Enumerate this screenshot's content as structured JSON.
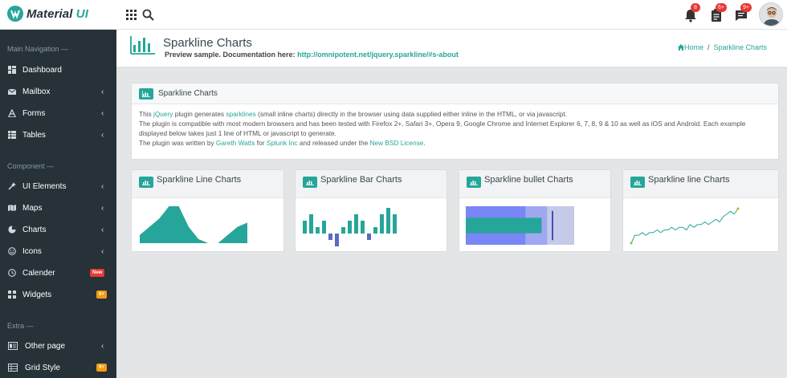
{
  "brand": {
    "name_part1": "Material",
    "name_part2": "UI",
    "accent": "#26a69a"
  },
  "topbar": {
    "icons": [
      "apps-grid-icon",
      "search-icon"
    ],
    "notifications": [
      {
        "icon": "bell-icon",
        "badge": "8"
      },
      {
        "icon": "clipboard-icon",
        "badge": "6+"
      },
      {
        "icon": "chat-icon",
        "badge": "9+"
      }
    ],
    "avatar": "user-avatar"
  },
  "sidebar": {
    "sections": [
      {
        "title": "Main Navigation —"
      },
      {
        "title": "Component —"
      },
      {
        "title": "Extra —"
      }
    ],
    "items": [
      {
        "label": "Dashboard",
        "icon": "dashboard-icon",
        "chevron": ""
      },
      {
        "label": "Mailbox",
        "icon": "mail-icon",
        "chevron": "‹"
      },
      {
        "label": "Forms",
        "icon": "font-icon",
        "chevron": "‹"
      },
      {
        "label": "Tables",
        "icon": "table-icon",
        "chevron": "‹"
      },
      {
        "label": "UI Elements",
        "icon": "wand-icon",
        "chevron": "‹"
      },
      {
        "label": "Maps",
        "icon": "map-icon",
        "chevron": "‹"
      },
      {
        "label": "Charts",
        "icon": "pie-chart-icon",
        "chevron": "‹"
      },
      {
        "label": "Icons",
        "icon": "smiley-icon",
        "chevron": "‹"
      },
      {
        "label": "Calender",
        "icon": "clock-icon",
        "chevron": "",
        "badge": "New",
        "badge_color": "#e53935"
      },
      {
        "label": "Widgets",
        "icon": "widgets-icon",
        "chevron": "",
        "badge": "9+",
        "badge_color": "#f39c12"
      },
      {
        "label": "Other page",
        "icon": "page-icon",
        "chevron": "‹"
      },
      {
        "label": "Grid Style",
        "icon": "grid-style-icon",
        "chevron": "",
        "badge": "9+",
        "badge_color": "#f39c12"
      }
    ]
  },
  "header": {
    "title": "Sparkline Charts",
    "subtitle_text": "Preview sample. Documentation here:",
    "subtitle_link": "http://omnipotent.net/jquery.sparkline/#s-about",
    "breadcrumb": {
      "home": "Home",
      "separator": "/",
      "current": "Sparkline Charts"
    }
  },
  "intro": {
    "title": "Sparkline Charts",
    "line1_a": "This ",
    "line1_link1": "jQuery",
    "line1_b": " plugin generates ",
    "line1_link2": "sparklines",
    "line1_c": " (small inline charts) directly in the browser using data supplied either inline in the HTML, or via javascript.",
    "line2": "The plugin is compatible with most modern browsers and has been tested with Firefox 2+, Safari 3+, Opera 9, Google Chrome and Internet Explorer 6, 7, 8, 9 & 10 as well as iOS and Android. Each example displayed below takes just 1 line of HTML or javascript to generate.",
    "line3_a": "The plugin was written by ",
    "line3_link1": "Gareth Watts",
    "line3_b": " for ",
    "line3_link2": "Splunk Inc",
    "line3_c": " and released under the ",
    "line3_link3": "New BSD License",
    "line3_d": "."
  },
  "cards": [
    {
      "title": "Sparkline Line Charts"
    },
    {
      "title": "Sparkline Bar Charts"
    },
    {
      "title": "Sparkline bullet Charts"
    },
    {
      "title": "Sparkline line Charts"
    }
  ],
  "chart_data": [
    {
      "type": "area",
      "values": [
        2,
        4,
        6,
        9,
        9,
        4,
        1,
        0,
        0,
        2,
        4,
        5
      ],
      "color": "#26a69a"
    },
    {
      "type": "bar",
      "values": [
        2,
        3,
        1,
        2,
        -1,
        -2,
        1,
        2,
        3,
        2,
        -1,
        1,
        3,
        4,
        3
      ],
      "positive_color": "#26a69a",
      "negative_color": "#5c6bc0"
    },
    {
      "type": "bullet",
      "target": 80,
      "performance": 70,
      "ranges": [
        100,
        75,
        55
      ],
      "range_colors": [
        "#c5cae9",
        "#9fa8f0",
        "#7986f5"
      ],
      "performance_color": "#26a69a",
      "target_color": "#3f51b5"
    },
    {
      "type": "line",
      "values": [
        1,
        4,
        4,
        5,
        4,
        5,
        5,
        6,
        5,
        6,
        6,
        7,
        6,
        7,
        7,
        6,
        8,
        7,
        8,
        8,
        9,
        8,
        9,
        10,
        9,
        11,
        12,
        13,
        12,
        14
      ],
      "color": "#26a69a",
      "spot_start": "#8bc34a",
      "spot_end": "#f39c12"
    }
  ]
}
